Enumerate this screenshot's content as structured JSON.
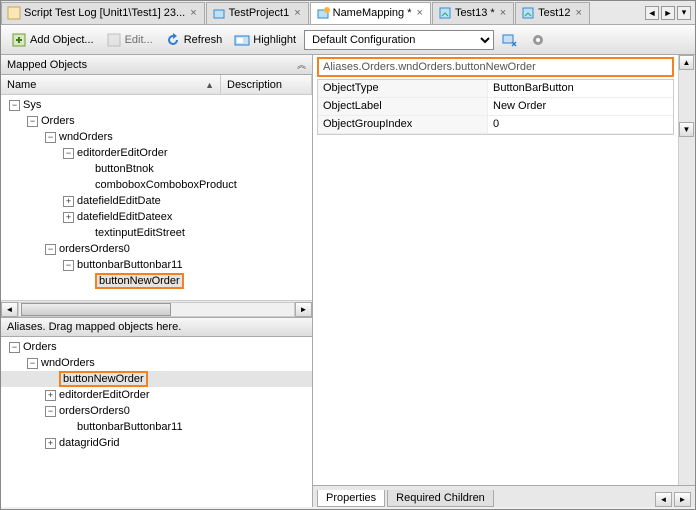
{
  "tabs": [
    {
      "label": "Script Test Log [Unit1\\Test1] 23...",
      "active": false
    },
    {
      "label": "TestProject1",
      "active": false
    },
    {
      "label": "NameMapping *",
      "active": true
    },
    {
      "label": "Test13 *",
      "active": false
    },
    {
      "label": "Test12",
      "active": false
    }
  ],
  "toolbar": {
    "add_object": "Add Object...",
    "edit": "Edit...",
    "refresh": "Refresh",
    "highlight": "Highlight",
    "config": "Default Configuration"
  },
  "mapped": {
    "title": "Mapped Objects",
    "col_name": "Name",
    "col_desc": "Description",
    "tree": [
      {
        "d": 0,
        "e": "-",
        "t": "Sys"
      },
      {
        "d": 1,
        "e": "-",
        "t": "Orders"
      },
      {
        "d": 2,
        "e": "-",
        "t": "wndOrders"
      },
      {
        "d": 3,
        "e": "-",
        "t": "editorderEditOrder"
      },
      {
        "d": 4,
        "e": "",
        "t": "buttonBtnok"
      },
      {
        "d": 4,
        "e": "",
        "t": "comboboxComboboxProduct"
      },
      {
        "d": 3,
        "e": "+",
        "t": "datefieldEditDate"
      },
      {
        "d": 3,
        "e": "+",
        "t": "datefieldEditDateex"
      },
      {
        "d": 4,
        "e": "",
        "t": "textinputEditStreet"
      },
      {
        "d": 2,
        "e": "-",
        "t": "ordersOrders0"
      },
      {
        "d": 3,
        "e": "-",
        "t": "buttonbarButtonbar11"
      },
      {
        "d": 4,
        "e": "",
        "t": "buttonNewOrder",
        "hl": true
      }
    ]
  },
  "aliases": {
    "title": "Aliases. Drag mapped objects here.",
    "tree": [
      {
        "d": 0,
        "e": "-",
        "t": "Orders"
      },
      {
        "d": 1,
        "e": "-",
        "t": "wndOrders"
      },
      {
        "d": 2,
        "e": "",
        "t": "buttonNewOrder",
        "hl": true,
        "sel": true
      },
      {
        "d": 2,
        "e": "+",
        "t": "editorderEditOrder"
      },
      {
        "d": 2,
        "e": "-",
        "t": "ordersOrders0"
      },
      {
        "d": 3,
        "e": "",
        "t": "buttonbarButtonbar11"
      },
      {
        "d": 2,
        "e": "+",
        "t": "datagridGrid"
      }
    ]
  },
  "path": "Aliases.Orders.wndOrders.buttonNewOrder",
  "props": [
    {
      "k": "ObjectType",
      "v": "ButtonBarButton"
    },
    {
      "k": "ObjectLabel",
      "v": "New Order"
    },
    {
      "k": "ObjectGroupIndex",
      "v": "0"
    }
  ],
  "bottom_tabs": {
    "properties": "Properties",
    "required": "Required Children"
  }
}
